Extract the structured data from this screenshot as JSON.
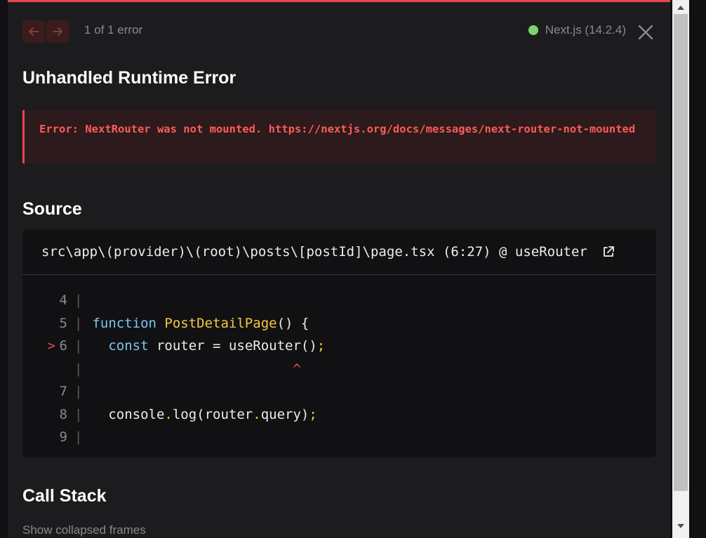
{
  "toolbar": {
    "error_count": "1 of 1 error",
    "version": "Next.js (14.2.4)",
    "status_color": "#7fd36a",
    "prev_icon": "arrow-left-icon",
    "next_icon": "arrow-right-icon",
    "close_icon": "close-icon"
  },
  "title": "Unhandled Runtime Error",
  "error": {
    "message": "Error: NextRouter was not mounted. https://nextjs.org/docs/messages/next-router-not-mounted",
    "accent_color": "#e5484d"
  },
  "source": {
    "heading": "Source",
    "file": "src\\app\\(provider)\\(root)\\posts\\[postId]\\page.tsx (6:27) @ useRouter",
    "open_icon": "external-link-icon",
    "lines": [
      {
        "marker": "",
        "num": "4",
        "segments": []
      },
      {
        "marker": "",
        "num": "5",
        "segments": [
          {
            "text": "function",
            "cls": "kw"
          },
          {
            "text": " ",
            "cls": ""
          },
          {
            "text": "PostDetailPage",
            "cls": "fn"
          },
          {
            "text": "() {",
            "cls": ""
          }
        ]
      },
      {
        "marker": ">",
        "num": "6",
        "segments": [
          {
            "text": "  ",
            "cls": ""
          },
          {
            "text": "const",
            "cls": "kw"
          },
          {
            "text": " router = useRouter()",
            "cls": ""
          },
          {
            "text": ";",
            "cls": "punct"
          }
        ]
      },
      {
        "marker": "",
        "num": "",
        "segments": [
          {
            "text": "                         ^",
            "cls": "caret"
          }
        ]
      },
      {
        "marker": "",
        "num": "7",
        "segments": []
      },
      {
        "marker": "",
        "num": "8",
        "segments": [
          {
            "text": "  console",
            "cls": ""
          },
          {
            "text": ".",
            "cls": "punct"
          },
          {
            "text": "log(router",
            "cls": ""
          },
          {
            "text": ".",
            "cls": "punct"
          },
          {
            "text": "query)",
            "cls": ""
          },
          {
            "text": ";",
            "cls": "punct"
          }
        ]
      },
      {
        "marker": "",
        "num": "9",
        "segments": []
      }
    ]
  },
  "call_stack": {
    "heading": "Call Stack",
    "toggle_label": "Show collapsed frames"
  }
}
